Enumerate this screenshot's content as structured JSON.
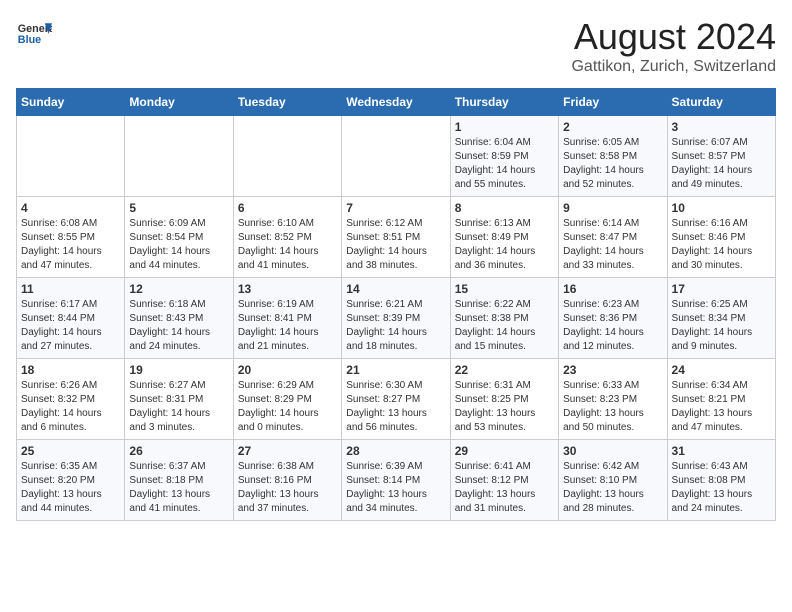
{
  "header": {
    "logo_line1": "General",
    "logo_line2": "Blue",
    "main_title": "August 2024",
    "subtitle": "Gattikon, Zurich, Switzerland"
  },
  "calendar": {
    "day_headers": [
      "Sunday",
      "Monday",
      "Tuesday",
      "Wednesday",
      "Thursday",
      "Friday",
      "Saturday"
    ],
    "weeks": [
      {
        "days": [
          {
            "number": "",
            "info": ""
          },
          {
            "number": "",
            "info": ""
          },
          {
            "number": "",
            "info": ""
          },
          {
            "number": "",
            "info": ""
          },
          {
            "number": "1",
            "info": "Sunrise: 6:04 AM\nSunset: 8:59 PM\nDaylight: 14 hours\nand 55 minutes."
          },
          {
            "number": "2",
            "info": "Sunrise: 6:05 AM\nSunset: 8:58 PM\nDaylight: 14 hours\nand 52 minutes."
          },
          {
            "number": "3",
            "info": "Sunrise: 6:07 AM\nSunset: 8:57 PM\nDaylight: 14 hours\nand 49 minutes."
          }
        ]
      },
      {
        "days": [
          {
            "number": "4",
            "info": "Sunrise: 6:08 AM\nSunset: 8:55 PM\nDaylight: 14 hours\nand 47 minutes."
          },
          {
            "number": "5",
            "info": "Sunrise: 6:09 AM\nSunset: 8:54 PM\nDaylight: 14 hours\nand 44 minutes."
          },
          {
            "number": "6",
            "info": "Sunrise: 6:10 AM\nSunset: 8:52 PM\nDaylight: 14 hours\nand 41 minutes."
          },
          {
            "number": "7",
            "info": "Sunrise: 6:12 AM\nSunset: 8:51 PM\nDaylight: 14 hours\nand 38 minutes."
          },
          {
            "number": "8",
            "info": "Sunrise: 6:13 AM\nSunset: 8:49 PM\nDaylight: 14 hours\nand 36 minutes."
          },
          {
            "number": "9",
            "info": "Sunrise: 6:14 AM\nSunset: 8:47 PM\nDaylight: 14 hours\nand 33 minutes."
          },
          {
            "number": "10",
            "info": "Sunrise: 6:16 AM\nSunset: 8:46 PM\nDaylight: 14 hours\nand 30 minutes."
          }
        ]
      },
      {
        "days": [
          {
            "number": "11",
            "info": "Sunrise: 6:17 AM\nSunset: 8:44 PM\nDaylight: 14 hours\nand 27 minutes."
          },
          {
            "number": "12",
            "info": "Sunrise: 6:18 AM\nSunset: 8:43 PM\nDaylight: 14 hours\nand 24 minutes."
          },
          {
            "number": "13",
            "info": "Sunrise: 6:19 AM\nSunset: 8:41 PM\nDaylight: 14 hours\nand 21 minutes."
          },
          {
            "number": "14",
            "info": "Sunrise: 6:21 AM\nSunset: 8:39 PM\nDaylight: 14 hours\nand 18 minutes."
          },
          {
            "number": "15",
            "info": "Sunrise: 6:22 AM\nSunset: 8:38 PM\nDaylight: 14 hours\nand 15 minutes."
          },
          {
            "number": "16",
            "info": "Sunrise: 6:23 AM\nSunset: 8:36 PM\nDaylight: 14 hours\nand 12 minutes."
          },
          {
            "number": "17",
            "info": "Sunrise: 6:25 AM\nSunset: 8:34 PM\nDaylight: 14 hours\nand 9 minutes."
          }
        ]
      },
      {
        "days": [
          {
            "number": "18",
            "info": "Sunrise: 6:26 AM\nSunset: 8:32 PM\nDaylight: 14 hours\nand 6 minutes."
          },
          {
            "number": "19",
            "info": "Sunrise: 6:27 AM\nSunset: 8:31 PM\nDaylight: 14 hours\nand 3 minutes."
          },
          {
            "number": "20",
            "info": "Sunrise: 6:29 AM\nSunset: 8:29 PM\nDaylight: 14 hours\nand 0 minutes."
          },
          {
            "number": "21",
            "info": "Sunrise: 6:30 AM\nSunset: 8:27 PM\nDaylight: 13 hours\nand 56 minutes."
          },
          {
            "number": "22",
            "info": "Sunrise: 6:31 AM\nSunset: 8:25 PM\nDaylight: 13 hours\nand 53 minutes."
          },
          {
            "number": "23",
            "info": "Sunrise: 6:33 AM\nSunset: 8:23 PM\nDaylight: 13 hours\nand 50 minutes."
          },
          {
            "number": "24",
            "info": "Sunrise: 6:34 AM\nSunset: 8:21 PM\nDaylight: 13 hours\nand 47 minutes."
          }
        ]
      },
      {
        "days": [
          {
            "number": "25",
            "info": "Sunrise: 6:35 AM\nSunset: 8:20 PM\nDaylight: 13 hours\nand 44 minutes."
          },
          {
            "number": "26",
            "info": "Sunrise: 6:37 AM\nSunset: 8:18 PM\nDaylight: 13 hours\nand 41 minutes."
          },
          {
            "number": "27",
            "info": "Sunrise: 6:38 AM\nSunset: 8:16 PM\nDaylight: 13 hours\nand 37 minutes."
          },
          {
            "number": "28",
            "info": "Sunrise: 6:39 AM\nSunset: 8:14 PM\nDaylight: 13 hours\nand 34 minutes."
          },
          {
            "number": "29",
            "info": "Sunrise: 6:41 AM\nSunset: 8:12 PM\nDaylight: 13 hours\nand 31 minutes."
          },
          {
            "number": "30",
            "info": "Sunrise: 6:42 AM\nSunset: 8:10 PM\nDaylight: 13 hours\nand 28 minutes."
          },
          {
            "number": "31",
            "info": "Sunrise: 6:43 AM\nSunset: 8:08 PM\nDaylight: 13 hours\nand 24 minutes."
          }
        ]
      }
    ]
  }
}
